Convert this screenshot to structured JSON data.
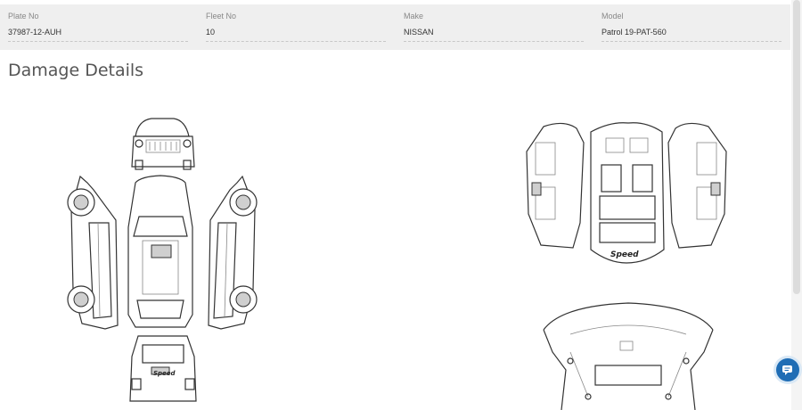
{
  "vehicle": {
    "plate_label": "Plate No",
    "plate_value": "37987-12-AUH",
    "fleet_label": "Fleet No",
    "fleet_value": "10",
    "make_label": "Make",
    "make_value": "NISSAN",
    "model_label": "Model",
    "model_value": "Patrol 19-PAT-560"
  },
  "damage": {
    "title": "Damage Details"
  },
  "diagram": {
    "logo_text": "Speed"
  },
  "icons": {
    "chat": "chat-bubble-icon"
  },
  "colors": {
    "chat_button": "#1f6db5",
    "info_bar": "#efefef"
  }
}
